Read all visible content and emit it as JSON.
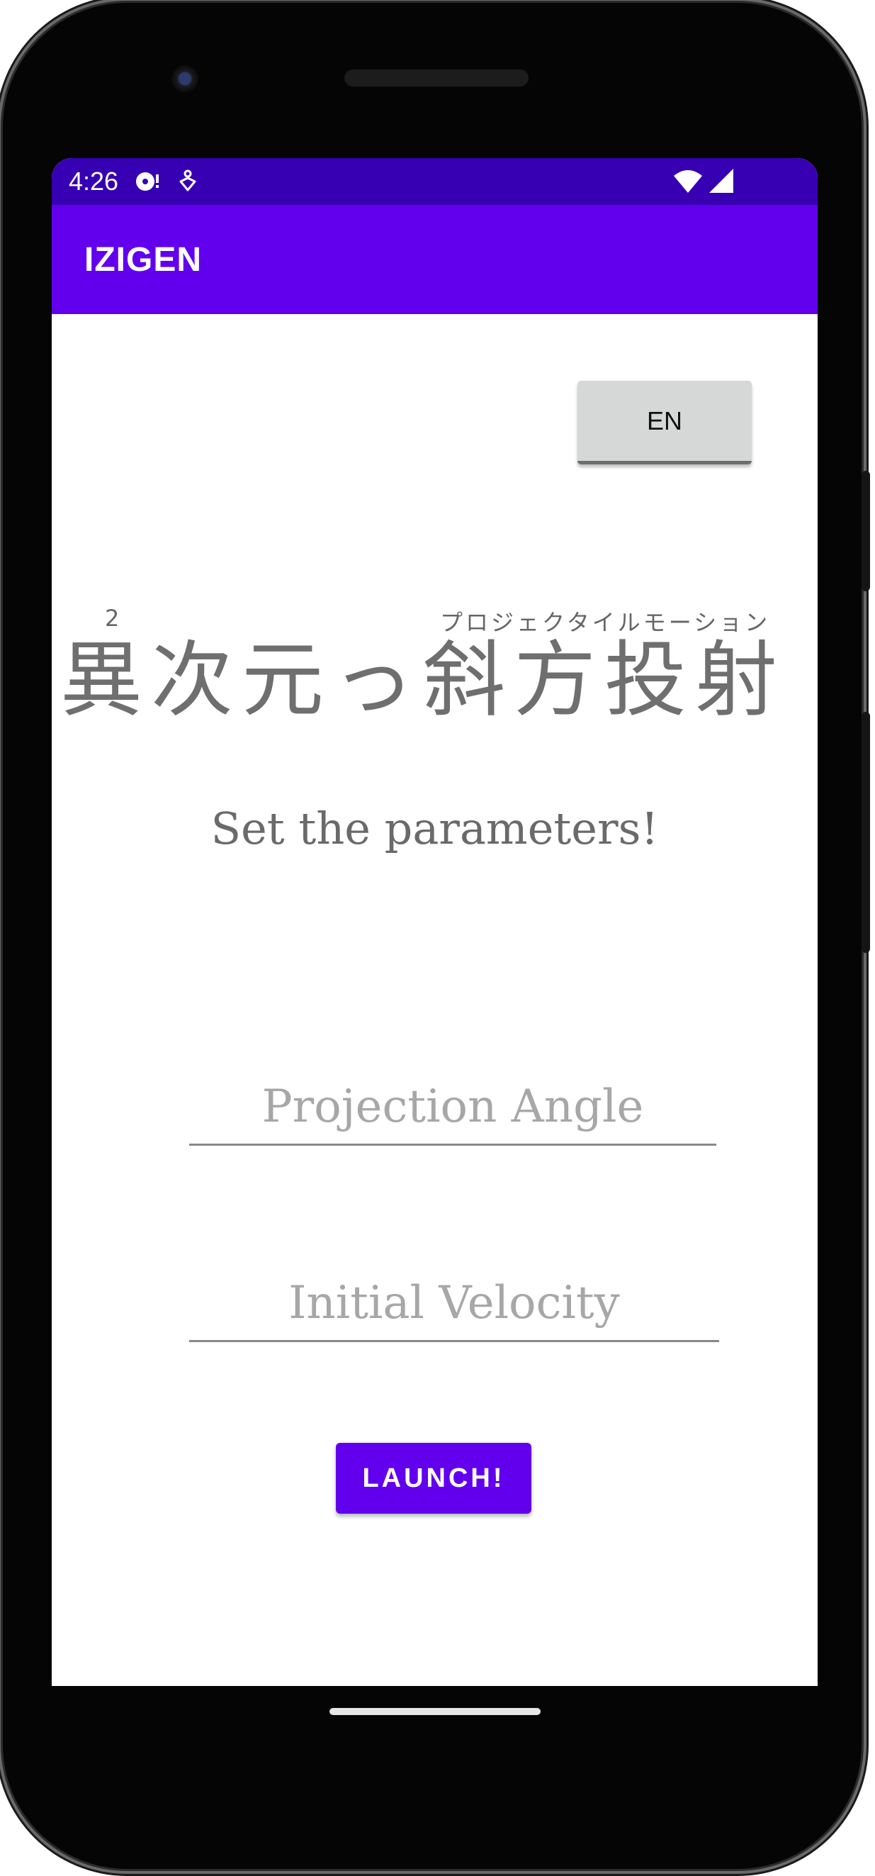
{
  "status_bar": {
    "time": "4:26",
    "icons": [
      "media-notification-icon",
      "accessibility-icon",
      "wifi-icon",
      "cellular-signal-icon"
    ]
  },
  "app_bar": {
    "title": "IZIGEN"
  },
  "language_button": {
    "label": "EN"
  },
  "title": {
    "furigana_left": "2",
    "furigana_right": "プロジェクタイルモーション",
    "main": "異次元っ斜方投射"
  },
  "subtitle": "Set the parameters!",
  "fields": {
    "angle": {
      "placeholder": "Projection Angle",
      "value": ""
    },
    "velocity": {
      "placeholder": "Initial Velocity",
      "value": ""
    }
  },
  "launch_button": {
    "label": "LAUNCH!"
  },
  "colors": {
    "status_bar": "#3700b3",
    "app_bar": "#6200ee",
    "accent": "#6200ee",
    "text_gray": "#6f6f6f",
    "placeholder_gray": "#a7a7a7"
  }
}
